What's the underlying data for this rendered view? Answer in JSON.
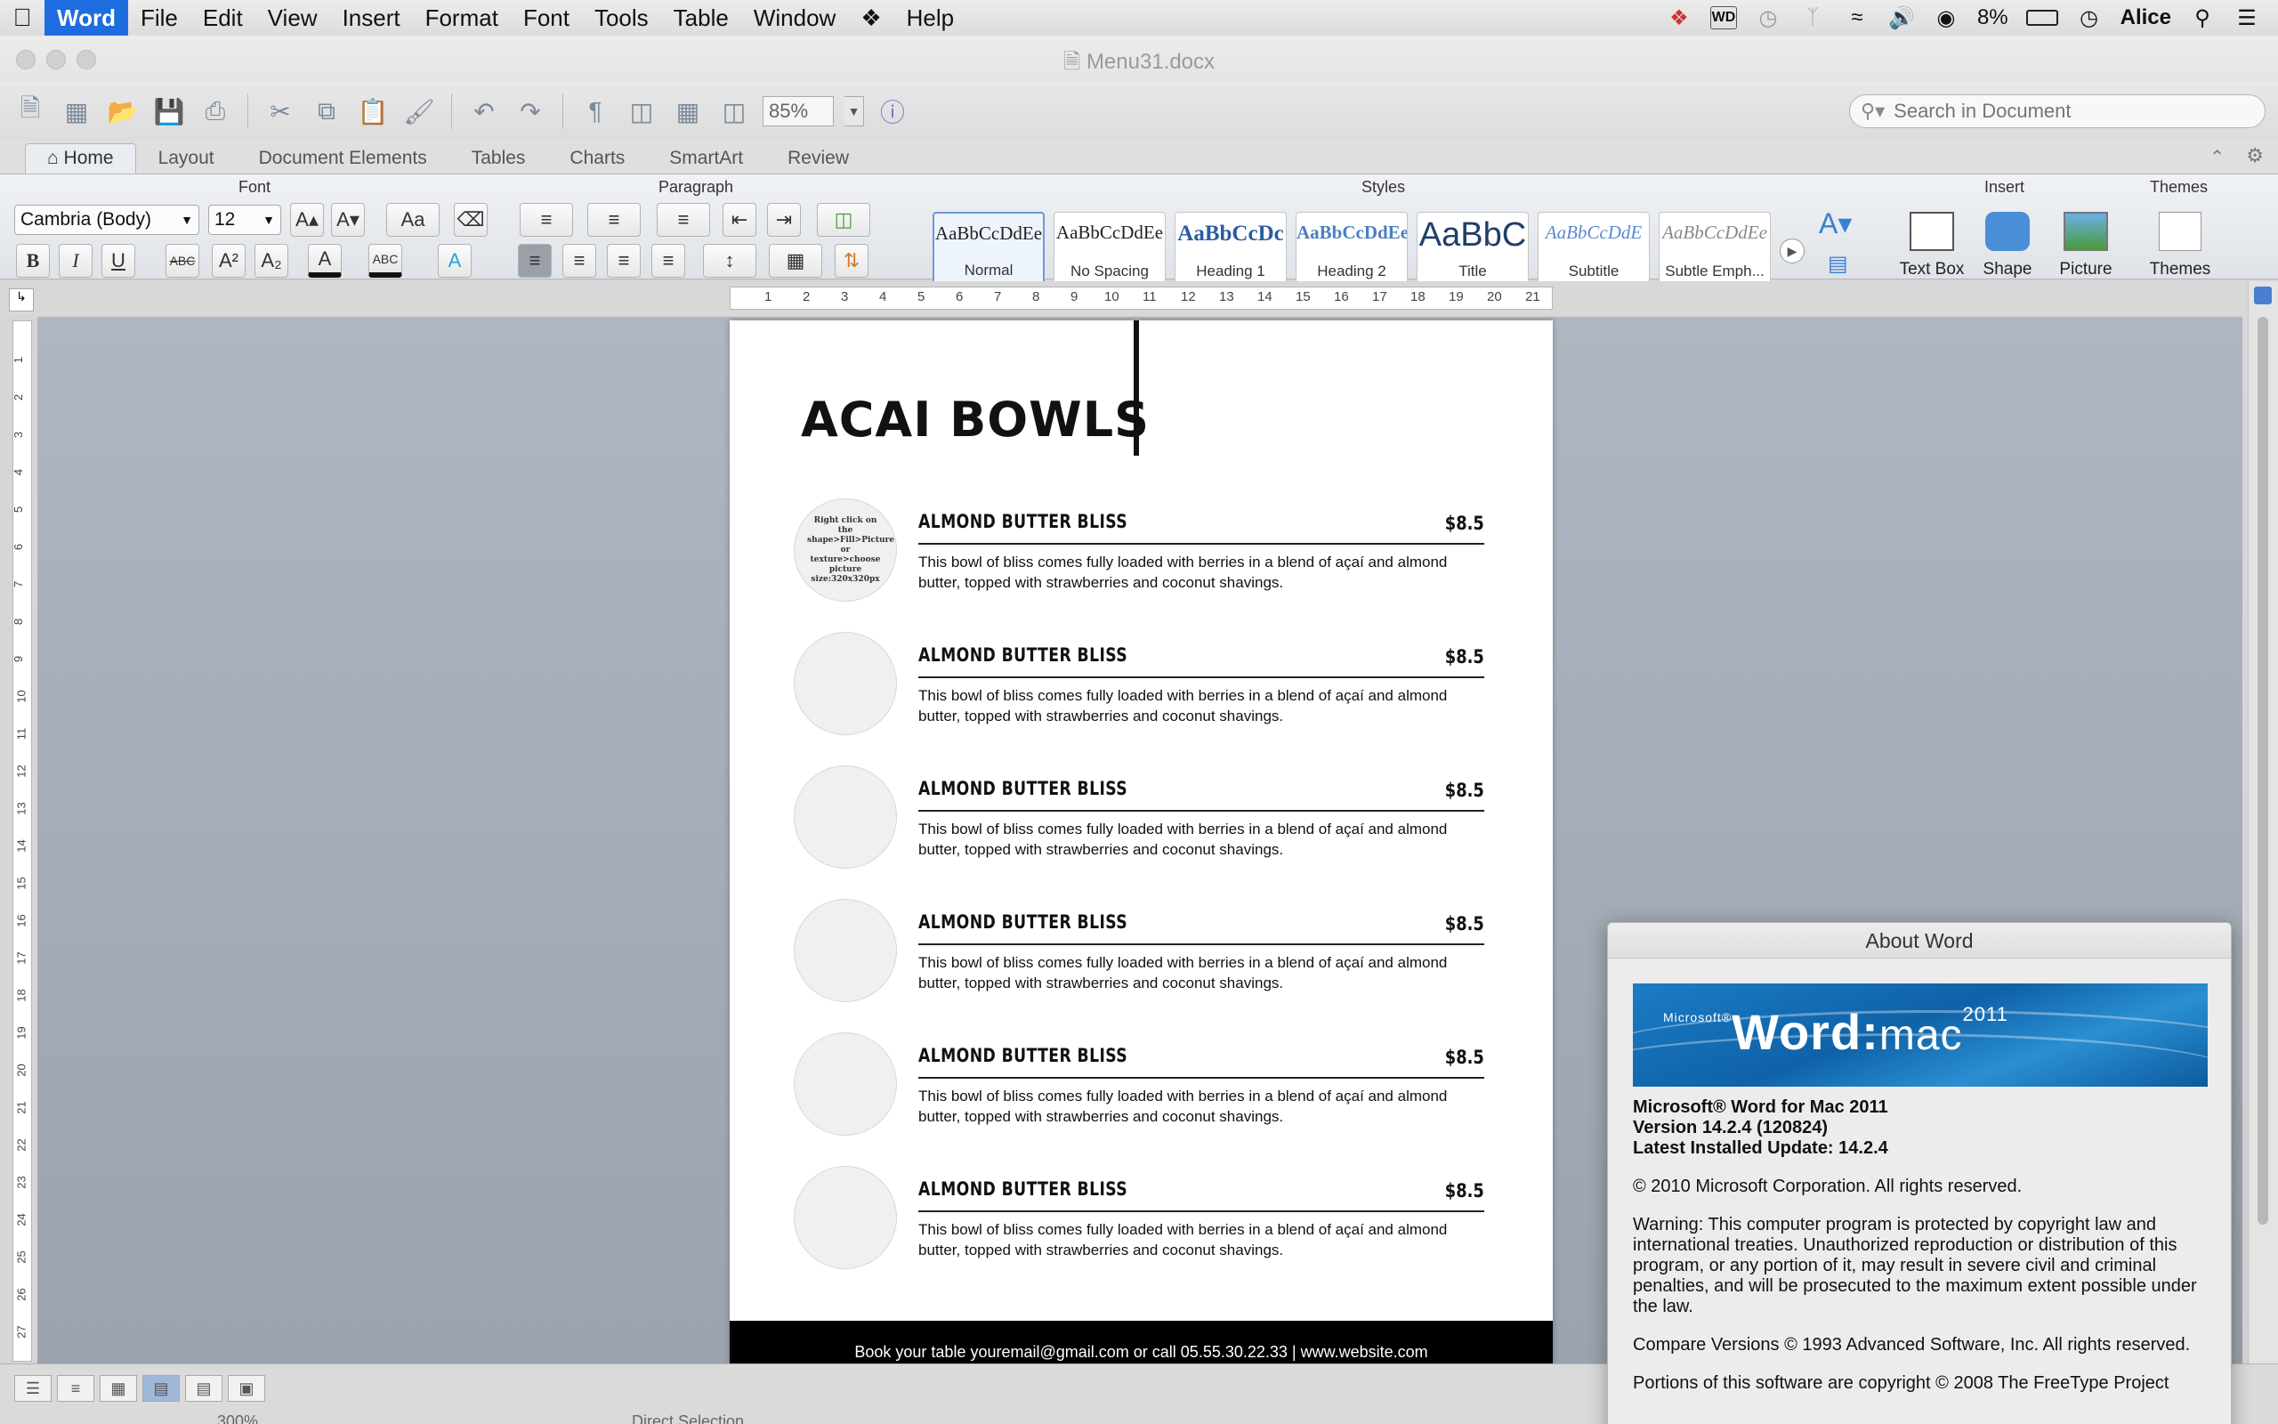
{
  "menubar": {
    "app": "Word",
    "items": [
      "File",
      "Edit",
      "View",
      "Insert",
      "Format",
      "Font",
      "Tools",
      "Table",
      "Window",
      "Help"
    ],
    "status": {
      "battery": "8%",
      "user": "Alice"
    }
  },
  "window": {
    "title": "Menu31.docx"
  },
  "toolbar": {
    "zoom": "85%",
    "search_placeholder": "Search in Document"
  },
  "ribbon": {
    "tabs": [
      "Home",
      "Layout",
      "Document Elements",
      "Tables",
      "Charts",
      "SmartArt",
      "Review"
    ],
    "groups": {
      "font": "Font",
      "paragraph": "Paragraph",
      "styles": "Styles",
      "insert": "Insert",
      "themes": "Themes"
    },
    "font_name": "Cambria (Body)",
    "font_size": "12",
    "styles": [
      {
        "sample": "AaBbCcDdEe",
        "name": "Normal"
      },
      {
        "sample": "AaBbCcDdEe",
        "name": "No Spacing"
      },
      {
        "sample": "AaBbCcDc",
        "name": "Heading 1"
      },
      {
        "sample": "AaBbCcDdEe",
        "name": "Heading 2"
      },
      {
        "sample": "AaBbC",
        "name": "Title"
      },
      {
        "sample": "AaBbCcDdE",
        "name": "Subtitle"
      },
      {
        "sample": "AaBbCcDdEe",
        "name": "Subtle Emph..."
      }
    ],
    "insert_buttons": [
      "Text Box",
      "Shape",
      "Picture"
    ],
    "themes_button": "Themes"
  },
  "ruler": {
    "ticks": [
      "1",
      "2",
      "3",
      "4",
      "5",
      "6",
      "7",
      "8",
      "9",
      "10",
      "11",
      "12",
      "13",
      "14",
      "15",
      "16",
      "17",
      "18",
      "19",
      "20",
      "21"
    ]
  },
  "vruler": {
    "ticks": [
      "1",
      "2",
      "3",
      "4",
      "5",
      "6",
      "7",
      "8",
      "9",
      "10",
      "11",
      "12",
      "13",
      "14",
      "15",
      "16",
      "17",
      "18",
      "19",
      "20",
      "21",
      "22",
      "23",
      "24",
      "25",
      "26",
      "27"
    ]
  },
  "document": {
    "title": "ACAI BOWLS",
    "placeholder_text": "Right click on the shape>Fill>Picture or texture>choose picture size:320x320px",
    "items": [
      {
        "name": "ALMOND BUTTER BLISS",
        "price": "$8.5",
        "description": "This bowl of bliss comes fully loaded with berries in a blend of açaí and almond butter, topped with strawberries and coconut shavings."
      },
      {
        "name": "ALMOND BUTTER BLISS",
        "price": "$8.5",
        "description": "This bowl of bliss comes fully loaded with berries in a blend of açaí and almond butter, topped with strawberries and coconut shavings."
      },
      {
        "name": "ALMOND BUTTER BLISS",
        "price": "$8.5",
        "description": "This bowl of bliss comes fully loaded with berries in a blend of açaí and almond butter, topped with strawberries and coconut shavings."
      },
      {
        "name": "ALMOND BUTTER BLISS",
        "price": "$8.5",
        "description": "This bowl of bliss comes fully loaded with berries in a blend of açaí and almond butter, topped with strawberries and coconut shavings."
      },
      {
        "name": "ALMOND BUTTER BLISS",
        "price": "$8.5",
        "description": "This bowl of bliss comes fully loaded with berries in a blend of açaí and almond butter, topped with strawberries and coconut shavings."
      },
      {
        "name": "ALMOND BUTTER BLISS",
        "price": "$8.5",
        "description": "This bowl of bliss comes fully loaded with berries in a blend of açaí and almond butter, topped with strawberries and coconut shavings."
      }
    ],
    "footer": "Book your table  youremail@gmail.com or call 05.55.30.22.33 |  www.website.com"
  },
  "statusbar": {
    "zoom_partial": "300%",
    "mode_partial": "Direct Selection"
  },
  "about": {
    "title": "About Word",
    "banner": {
      "brand": "Microsoft®",
      "word": "Word",
      "mac": "mac",
      "year": "2011"
    },
    "product": "Microsoft® Word for Mac 2011",
    "version": "Version 14.2.4 (120824)",
    "update": "Latest Installed Update: 14.2.4",
    "copyright": "© 2010 Microsoft Corporation. All rights reserved.",
    "warning": "Warning: This computer program is protected by copyright law and international treaties.  Unauthorized reproduction or distribution of this program, or any portion of it, may result in severe civil and criminal penalties, and will be prosecuted to the maximum extent possible under the law.",
    "compare": "Compare Versions © 1993 Advanced Software, Inc.  All rights reserved.",
    "portions": "Portions of this software are copyright © 2008 The FreeType Project"
  }
}
